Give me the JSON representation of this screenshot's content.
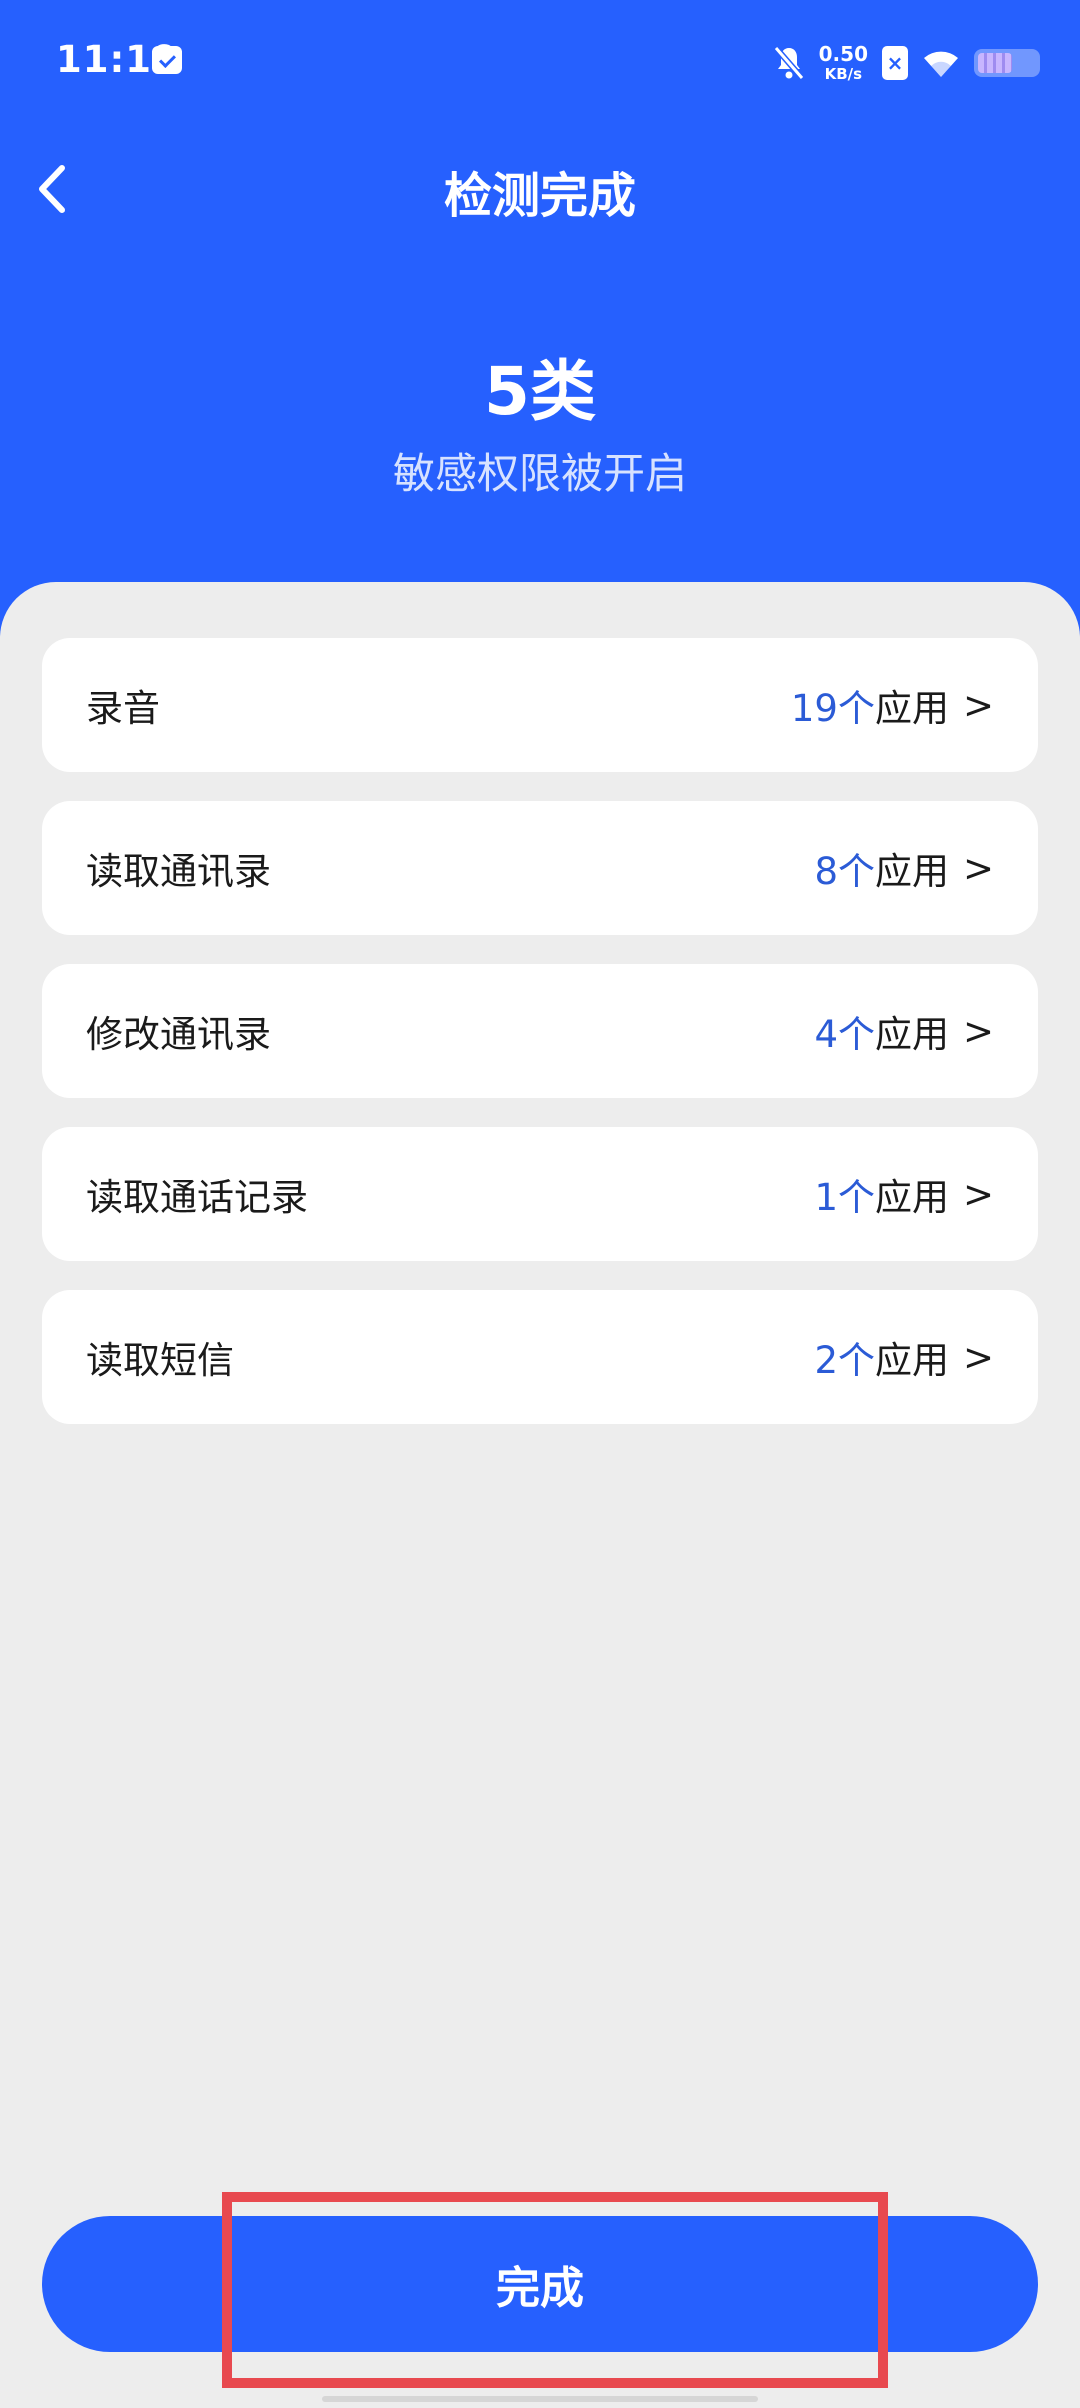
{
  "status_bar": {
    "time": "11:19",
    "net_speed_value": "0.50",
    "net_speed_unit": "KB/s",
    "sim_label": "×",
    "icons": [
      "message-icon",
      "bell-off-icon",
      "sim-icon",
      "wifi-icon",
      "battery-icon"
    ]
  },
  "header": {
    "title": "检测完成",
    "summary_count": "5类",
    "summary_desc": "敏感权限被开启"
  },
  "permissions": [
    {
      "name": "录音",
      "count": "19个",
      "suffix": "应用",
      "chevron": ">"
    },
    {
      "name": "读取通讯录",
      "count": "8个",
      "suffix": "应用",
      "chevron": ">"
    },
    {
      "name": "修改通讯录",
      "count": "4个",
      "suffix": "应用",
      "chevron": ">"
    },
    {
      "name": "读取通话记录",
      "count": "1个",
      "suffix": "应用",
      "chevron": ">"
    },
    {
      "name": "读取短信",
      "count": "2个",
      "suffix": "应用",
      "chevron": ">"
    }
  ],
  "footer": {
    "done_label": "完成"
  },
  "colors": {
    "primary": "#2660fe",
    "count_text": "#2b5bd6",
    "background": "#ededed",
    "highlight": "#e8494f"
  }
}
